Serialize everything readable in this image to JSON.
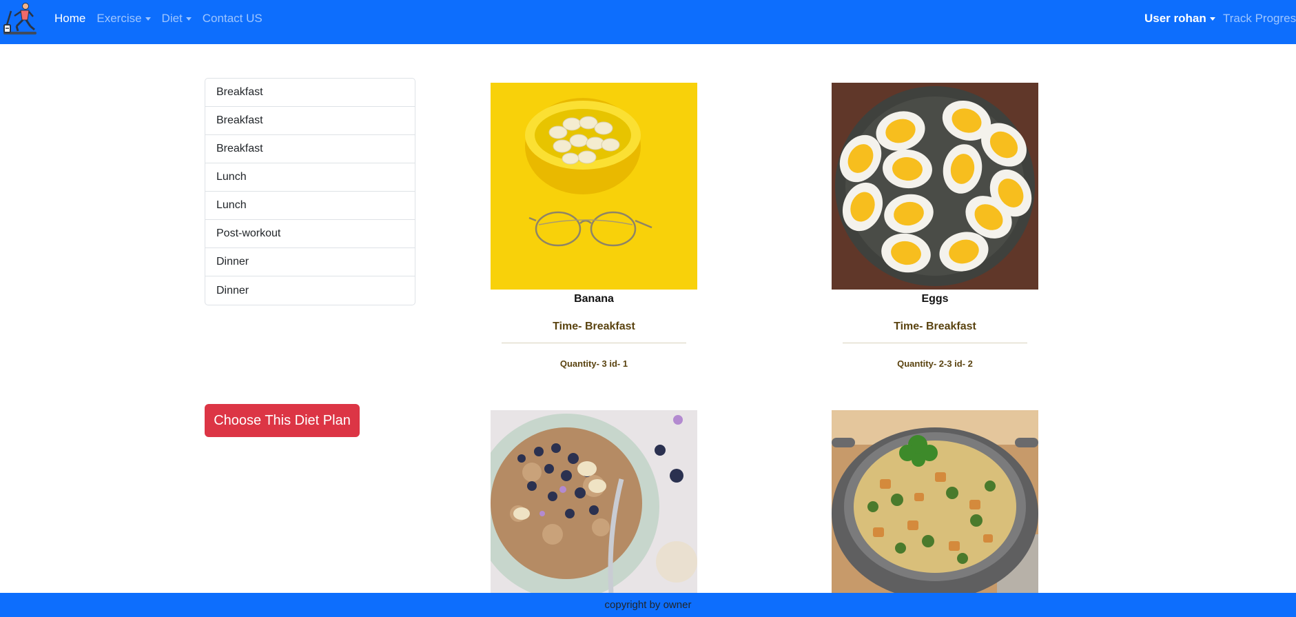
{
  "nav": {
    "logo_icon": "treadmill-runner-icon",
    "links": [
      {
        "label": "Home",
        "active": true,
        "dropdown": false
      },
      {
        "label": "Exercise",
        "active": false,
        "dropdown": true
      },
      {
        "label": "Diet",
        "active": false,
        "dropdown": true
      },
      {
        "label": "Contact US",
        "active": false,
        "dropdown": false
      }
    ],
    "user_label": "User rohan",
    "track_label": "Track Progress"
  },
  "sidebar": {
    "items": [
      {
        "label": "Breakfast"
      },
      {
        "label": "Breakfast"
      },
      {
        "label": "Breakfast"
      },
      {
        "label": "Lunch"
      },
      {
        "label": "Lunch"
      },
      {
        "label": "Post-workout"
      },
      {
        "label": "Dinner"
      },
      {
        "label": "Dinner"
      }
    ],
    "choose_label": "Choose This Diet Plan"
  },
  "cards": [
    {
      "name": "Banana",
      "time": "Time- Breakfast",
      "quantity": "Quantity- 3 id- 1",
      "image": "banana-bowl-photo"
    },
    {
      "name": "Eggs",
      "time": "Time- Breakfast",
      "quantity": "Quantity- 2-3 id- 2",
      "image": "boiled-eggs-photo"
    },
    {
      "image": "oatmeal-blueberry-photo"
    },
    {
      "image": "vegetable-rice-photo"
    }
  ],
  "footer": {
    "text": "copyright by owner"
  },
  "colors": {
    "primary": "#0d6efd",
    "danger": "#dc3545"
  }
}
